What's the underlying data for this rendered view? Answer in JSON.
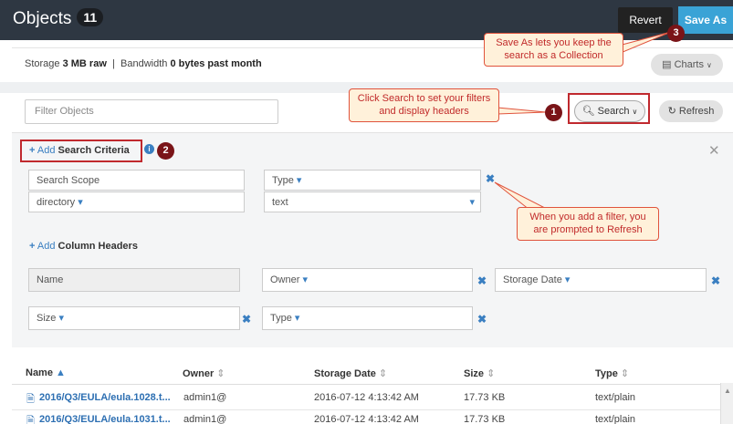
{
  "header": {
    "title": "Objects",
    "count": "11",
    "revert_label": "Revert",
    "save_as_label": "Save As"
  },
  "storage": {
    "label": "Storage",
    "value": "3 MB raw",
    "separator": "|",
    "bandwidth_label": "Bandwidth",
    "bandwidth_value": "0 bytes past month",
    "charts_label": "Charts"
  },
  "filter": {
    "placeholder": "Filter Objects",
    "search_label": "Search",
    "refresh_label": "Refresh"
  },
  "criteria": {
    "add_prefix": "Add",
    "add_label": "Search Criteria",
    "scope_label": "Search Scope",
    "scope_value": "directory",
    "type_label": "Type",
    "type_value": "text"
  },
  "columns": {
    "add_prefix": "Add",
    "add_label": "Column Headers",
    "fields": [
      "Name",
      "Owner",
      "Storage Date",
      "Size",
      "Type"
    ]
  },
  "table": {
    "headers": [
      "Name",
      "Owner",
      "Storage Date",
      "Size",
      "Type"
    ],
    "rows": [
      {
        "name": "2016/Q3/EULA/eula.1028.t...",
        "owner": "admin1@",
        "date": "2016-07-12 4:13:42 AM",
        "size": "17.73 KB",
        "type": "text/plain"
      },
      {
        "name": "2016/Q3/EULA/eula.1031.t...",
        "owner": "admin1@",
        "date": "2016-07-12 4:13:42 AM",
        "size": "17.73 KB",
        "type": "text/plain"
      }
    ]
  },
  "callouts": {
    "c1_text": "Click Search to set your filters and display headers",
    "c1_num": "1",
    "c2_num": "2",
    "c3_text": "Save As lets you keep the search as a Collection",
    "c3_num": "3",
    "filter_text": "When you add a filter, you are prompted to Refresh"
  }
}
